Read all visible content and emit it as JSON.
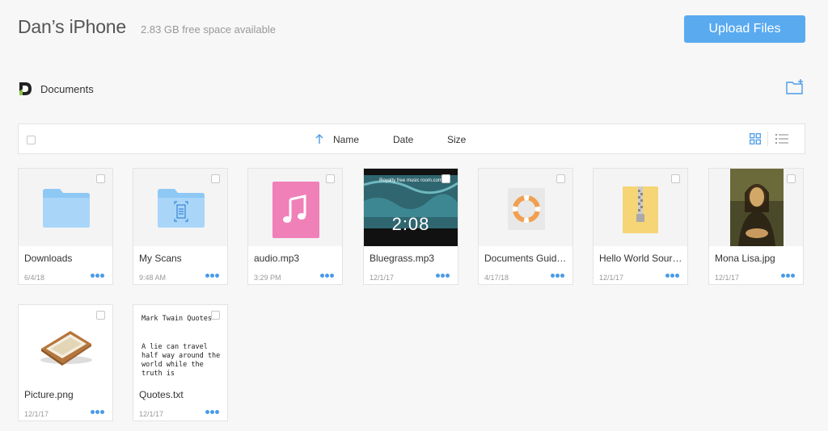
{
  "header": {
    "device_name": "Dan’s iPhone",
    "free_space": "2.83 GB free space available",
    "upload_label": "Upload Files"
  },
  "breadcrumb": {
    "label": "Documents"
  },
  "toolbar": {
    "columns": {
      "name": "Name",
      "date": "Date",
      "size": "Size"
    }
  },
  "files": [
    {
      "name": "Downloads",
      "date": "6/4/18",
      "icon": "folder-icon"
    },
    {
      "name": "My Scans",
      "date": "9:48 AM",
      "icon": "scan-folder-icon"
    },
    {
      "name": "audio.mp3",
      "date": "3:29 PM",
      "icon": "music-note-icon"
    },
    {
      "name": "Bluegrass.mp3",
      "date": "12/1/17",
      "icon": "video-thumbnail",
      "overlay": "2:08",
      "banner": "Royalty free music room.com"
    },
    {
      "name": "Documents Guid…",
      "date": "4/17/18",
      "icon": "lifebuoy-icon"
    },
    {
      "name": "Hello World Sour…",
      "date": "12/1/17",
      "icon": "zip-archive-icon"
    },
    {
      "name": "Mona Lisa.jpg",
      "date": "12/1/17",
      "icon": "image-thumbnail"
    },
    {
      "name": "Picture.png",
      "date": "12/1/17",
      "icon": "picture-frame-icon"
    },
    {
      "name": "Quotes.txt",
      "date": "12/1/17",
      "icon": "text-preview",
      "preview_title": "Mark Twain Quotes",
      "preview_body": "A lie can travel half way around the world while the truth is"
    }
  ],
  "colors": {
    "accent": "#4a9be8",
    "button": "#5aaaf0"
  }
}
